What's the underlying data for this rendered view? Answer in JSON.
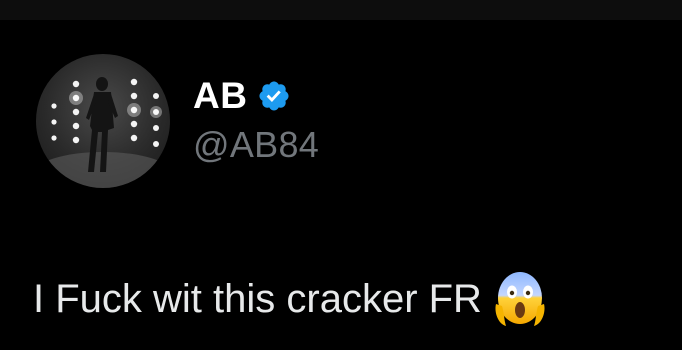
{
  "tweet": {
    "author": {
      "display_name": "AB",
      "handle": "@AB84",
      "verified": true
    },
    "text": "I Fuck wit this cracker FR",
    "emoji": "face-screaming-in-fear-emoji"
  },
  "colors": {
    "background": "#000000",
    "text": "#e7e9ea",
    "handle": "#71767b",
    "verified_badge": "#1d9bf0"
  }
}
